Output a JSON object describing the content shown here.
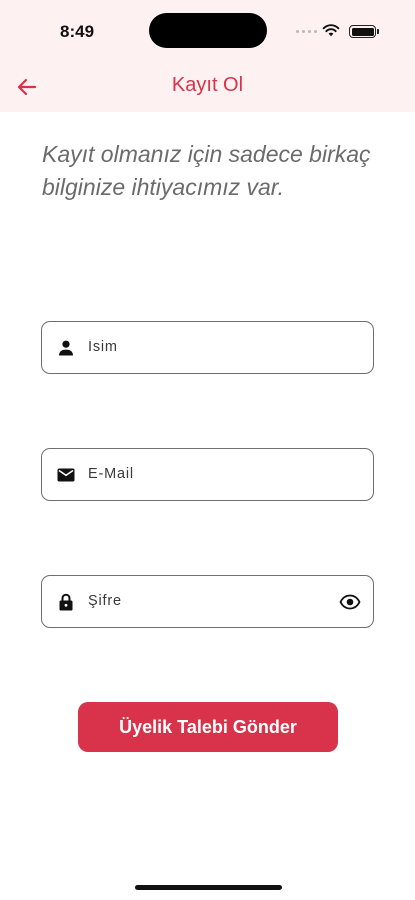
{
  "status_bar": {
    "time": "8:49"
  },
  "app_bar": {
    "title": "Kayıt Ol",
    "back_icon": "arrow-left-icon"
  },
  "intro_text": "Kayıt olmanız için sadece birkaç bilginize ihtiyacımız var.",
  "form": {
    "name": {
      "placeholder": "İsim",
      "icon": "person-icon"
    },
    "email": {
      "placeholder": "E-Mail",
      "icon": "envelope-icon"
    },
    "password": {
      "placeholder": "Şifre",
      "icon": "lock-icon",
      "toggle_icon": "eye-icon"
    }
  },
  "submit_label": "Üyelik Talebi Gönder",
  "colors": {
    "accent": "#d8334a",
    "header_bg": "#fdf1f1",
    "intro_text": "#6b6b6b"
  }
}
